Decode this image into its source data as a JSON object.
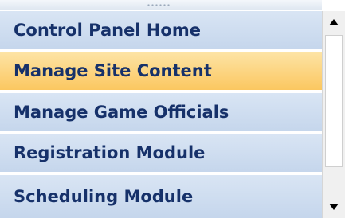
{
  "menu": {
    "items": [
      {
        "label": "Control Panel Home",
        "active": false
      },
      {
        "label": "Manage Site Content",
        "active": true
      },
      {
        "label": "Manage Game Officials",
        "active": false
      },
      {
        "label": "Registration Module",
        "active": false
      },
      {
        "label": "Scheduling Module",
        "active": false
      }
    ]
  },
  "scrollbar": {
    "up_icon": "triangle-up-icon",
    "down_icon": "triangle-down-icon"
  },
  "colors": {
    "item_bg": "#c5d6ec",
    "active_bg": "#fbc760",
    "label": "#16316a"
  }
}
